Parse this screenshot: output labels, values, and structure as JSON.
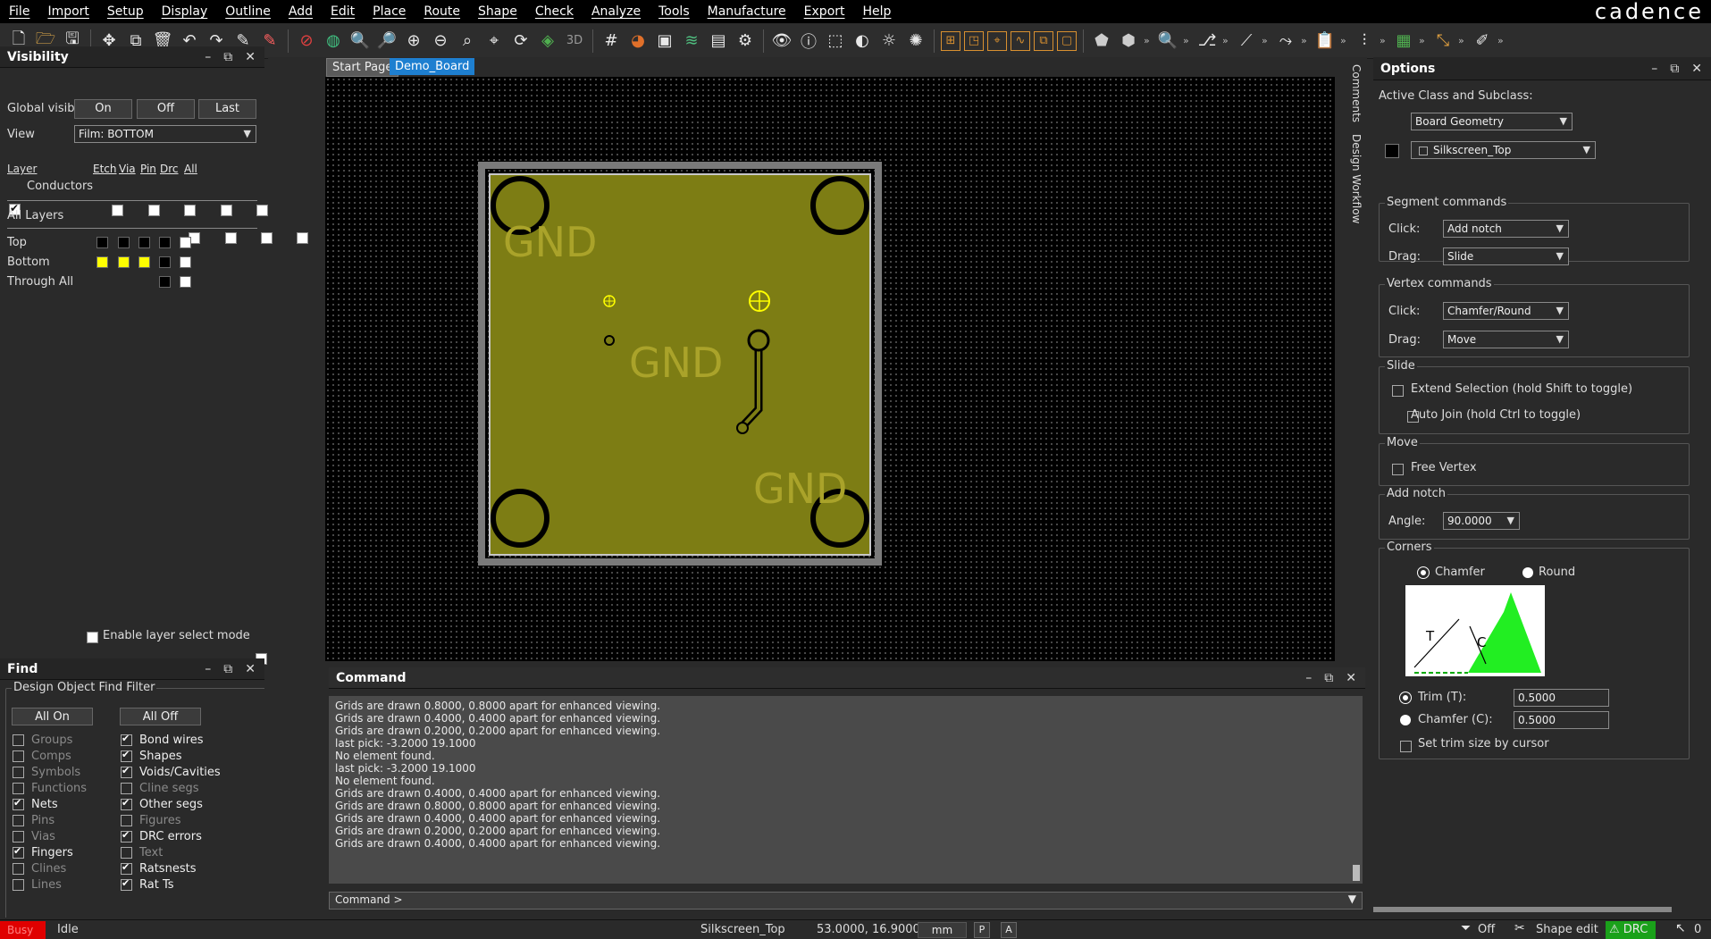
{
  "app": {
    "brand": "cadence"
  },
  "menu": [
    "File",
    "Import",
    "Setup",
    "Display",
    "Outline",
    "Add",
    "Edit",
    "Place",
    "Route",
    "Shape",
    "Check",
    "Analyze",
    "Tools",
    "Manufacture",
    "Export",
    "Help"
  ],
  "tabs": {
    "start": "Start Page",
    "design": "Demo_Board"
  },
  "side_tabs": {
    "comments": "Comments",
    "workflow": "Design Workflow"
  },
  "visibility": {
    "title": "Visibility",
    "global_label": "Global visibility",
    "on": "On",
    "off": "Off",
    "last": "Last",
    "view_label": "View",
    "view_value": "Film: BOTTOM",
    "layer_hdr": "Layer",
    "cols": [
      "Etch",
      "Via",
      "Pin",
      "Drc",
      "All"
    ],
    "conductors": "Conductors",
    "all_layers": "All Layers",
    "rows": [
      "Top",
      "Bottom",
      "Through All"
    ],
    "enable_select": "Enable layer select mode"
  },
  "find": {
    "title": "Find",
    "filter": "Design Object Find Filter",
    "all_on": "All On",
    "all_off": "All Off",
    "left": [
      {
        "label": "Groups",
        "checked": false
      },
      {
        "label": "Comps",
        "checked": false
      },
      {
        "label": "Symbols",
        "checked": false
      },
      {
        "label": "Functions",
        "checked": false
      },
      {
        "label": "Nets",
        "checked": true
      },
      {
        "label": "Pins",
        "checked": false
      },
      {
        "label": "Vias",
        "checked": false
      },
      {
        "label": "Fingers",
        "checked": true
      },
      {
        "label": "Clines",
        "checked": false
      },
      {
        "label": "Lines",
        "checked": false
      }
    ],
    "right": [
      {
        "label": "Bond wires",
        "checked": true
      },
      {
        "label": "Shapes",
        "checked": true
      },
      {
        "label": "Voids/Cavities",
        "checked": true
      },
      {
        "label": "Cline segs",
        "checked": false
      },
      {
        "label": "Other segs",
        "checked": true
      },
      {
        "label": "Figures",
        "checked": false
      },
      {
        "label": "DRC errors",
        "checked": true
      },
      {
        "label": "Text",
        "checked": false
      },
      {
        "label": "Ratsnests",
        "checked": true
      },
      {
        "label": "Rat Ts",
        "checked": true
      }
    ]
  },
  "board": {
    "gnd": "GND"
  },
  "command": {
    "title": "Command",
    "prompt": "Command >",
    "lines": [
      "Grids are drawn 0.8000, 0.8000 apart for enhanced viewing.",
      "Grids are drawn 0.4000, 0.4000 apart for enhanced viewing.",
      "Grids are drawn 0.2000, 0.2000 apart for enhanced viewing.",
      "last pick:  -3.2000 19.1000",
      "No element found.",
      "last pick:  -3.2000 19.1000",
      "No element found.",
      "Grids are drawn 0.4000, 0.4000 apart for enhanced viewing.",
      "Grids are drawn 0.8000, 0.8000 apart for enhanced viewing.",
      "Grids are drawn 0.4000, 0.4000 apart for enhanced viewing.",
      "Grids are drawn 0.2000, 0.2000 apart for enhanced viewing.",
      "Grids are drawn 0.4000, 0.4000 apart for enhanced viewing."
    ]
  },
  "options": {
    "title": "Options",
    "active_label": "Active Class and Subclass:",
    "class_value": "Board Geometry",
    "subclass_value": "Silkscreen_Top",
    "segment": {
      "title": "Segment commands",
      "click_label": "Click:",
      "click_value": "Add notch",
      "drag_label": "Drag:",
      "drag_value": "Slide"
    },
    "vertex": {
      "title": "Vertex commands",
      "click_label": "Click:",
      "click_value": "Chamfer/Round",
      "drag_label": "Drag:",
      "drag_value": "Move"
    },
    "slide": {
      "title": "Slide",
      "extend": "Extend Selection (hold Shift to toggle)",
      "autojoin": "Auto Join (hold Ctrl to toggle)"
    },
    "move": {
      "title": "Move",
      "free": "Free Vertex"
    },
    "notch": {
      "title": "Add notch",
      "angle_label": "Angle:",
      "angle_value": "90.0000"
    },
    "corners": {
      "title": "Corners",
      "chamfer": "Chamfer",
      "round": "Round",
      "t": "T",
      "c": "C",
      "trim_label": "Trim (T):",
      "trim_value": "0.5000",
      "chamfer_label": "Chamfer (C):",
      "chamfer_value": "0.5000",
      "set_trim": "Set trim size by cursor"
    }
  },
  "status": {
    "busy": "Busy",
    "idle": "Idle",
    "subclass": "Silkscreen_Top",
    "coords": "53.0000, 16.9000",
    "units": "mm",
    "p": "P",
    "a": "A",
    "filter": "Off",
    "mode": "Shape edit",
    "drc": "DRC",
    "count": "0"
  },
  "colors": {
    "accent": "#1e7fd0",
    "board": "#7d7d14",
    "yellow": "#ffff00",
    "drc_green": "#1aa11a",
    "busy_red": "#e00000"
  }
}
